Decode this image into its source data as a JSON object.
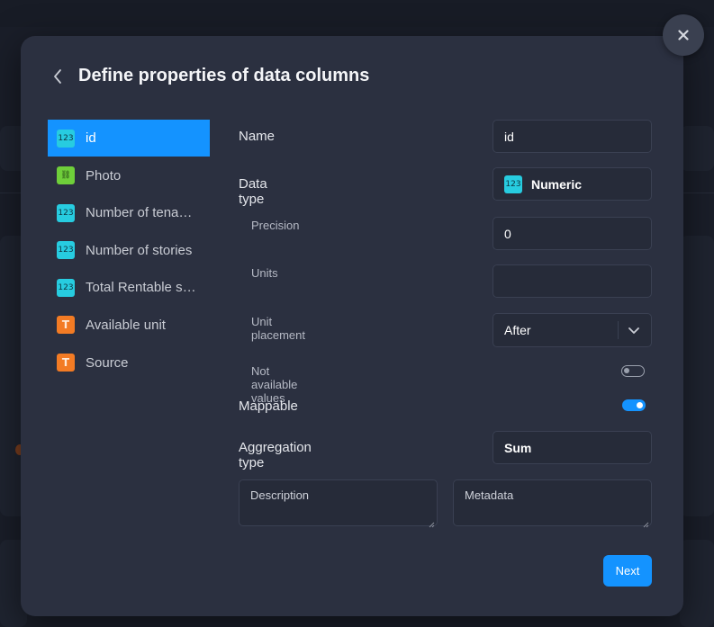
{
  "dialog": {
    "title": "Define properties of data columns",
    "next_label": "Next"
  },
  "columns": [
    {
      "label": "id",
      "type": "numeric",
      "icon": "numeric-type-icon",
      "active": true
    },
    {
      "label": "Photo",
      "type": "link",
      "icon": "link-type-icon",
      "active": false
    },
    {
      "label": "Number of tena…",
      "type": "numeric",
      "icon": "numeric-type-icon",
      "active": false
    },
    {
      "label": "Number of stories",
      "type": "numeric",
      "icon": "numeric-type-icon",
      "active": false
    },
    {
      "label": "Total Rentable s…",
      "type": "numeric",
      "icon": "numeric-type-icon",
      "active": false
    },
    {
      "label": "Available unit",
      "type": "text",
      "icon": "text-type-icon",
      "active": false
    },
    {
      "label": "Source",
      "type": "text",
      "icon": "text-type-icon",
      "active": false
    }
  ],
  "icon_glyphs": {
    "numeric": "123",
    "link": "⛓",
    "text": "T"
  },
  "form": {
    "name_label": "Name",
    "name_value": "id",
    "data_type_label": "Data type",
    "data_type_value": "Numeric",
    "precision_label": "Precision",
    "precision_value": "0",
    "units_label": "Units",
    "units_value": "",
    "unit_placement_label": "Unit placement",
    "unit_placement_value": "After",
    "not_available_label": "Not available values",
    "not_available_on": false,
    "mappable_label": "Mappable",
    "mappable_on": true,
    "aggregation_label": "Aggregation type",
    "aggregation_value": "Sum",
    "description_placeholder": "Description",
    "metadata_placeholder": "Metadata"
  },
  "colors": {
    "accent": "#1493ff",
    "numeric": "#27cce0",
    "link": "#6fcf3a",
    "text": "#f37b24"
  }
}
